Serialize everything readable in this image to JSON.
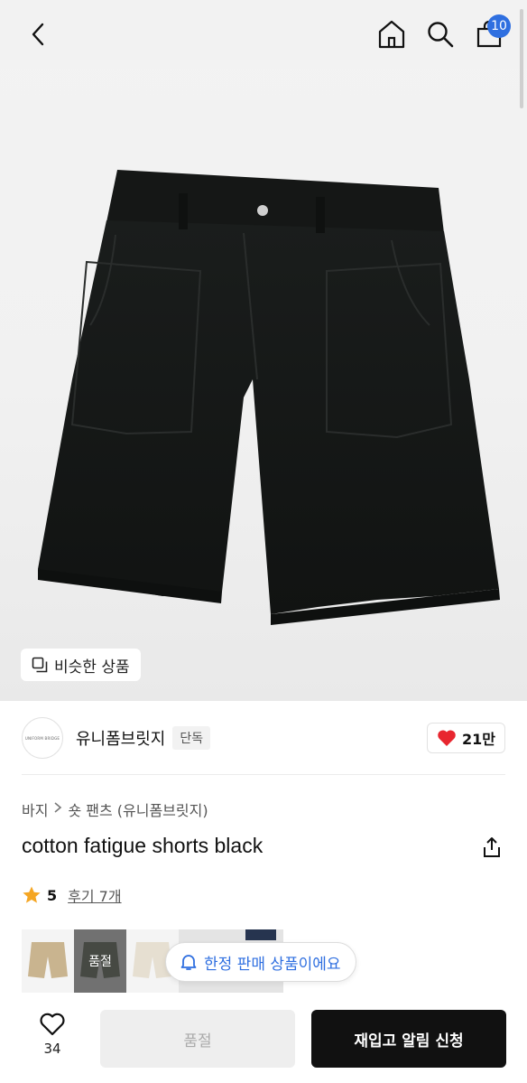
{
  "header": {
    "cart_count": "10"
  },
  "hero": {
    "similar_label": "비슷한 상품"
  },
  "brand": {
    "logo_text": "UNIFORM BRIDGE",
    "name": "유니폼브릿지",
    "tag": "단독",
    "likes": "21만"
  },
  "breadcrumb": {
    "items": [
      "바지",
      "숏 팬츠 (유니폼브릿지)"
    ]
  },
  "product": {
    "title": "cotton fatigue shorts black",
    "rating": "5",
    "reviews": "후기 7개"
  },
  "swatches": {
    "sold_label": "품절"
  },
  "notice": {
    "limited": "한정 판매 상품이에요"
  },
  "bottom": {
    "like_count": "34",
    "soldout_label": "품절",
    "restock_label": "재입고 알림 신청"
  },
  "colors": {
    "accent": "#2f6fe0",
    "heart": "#e8262f",
    "star": "#f5a623",
    "primary_button": "#111111"
  }
}
